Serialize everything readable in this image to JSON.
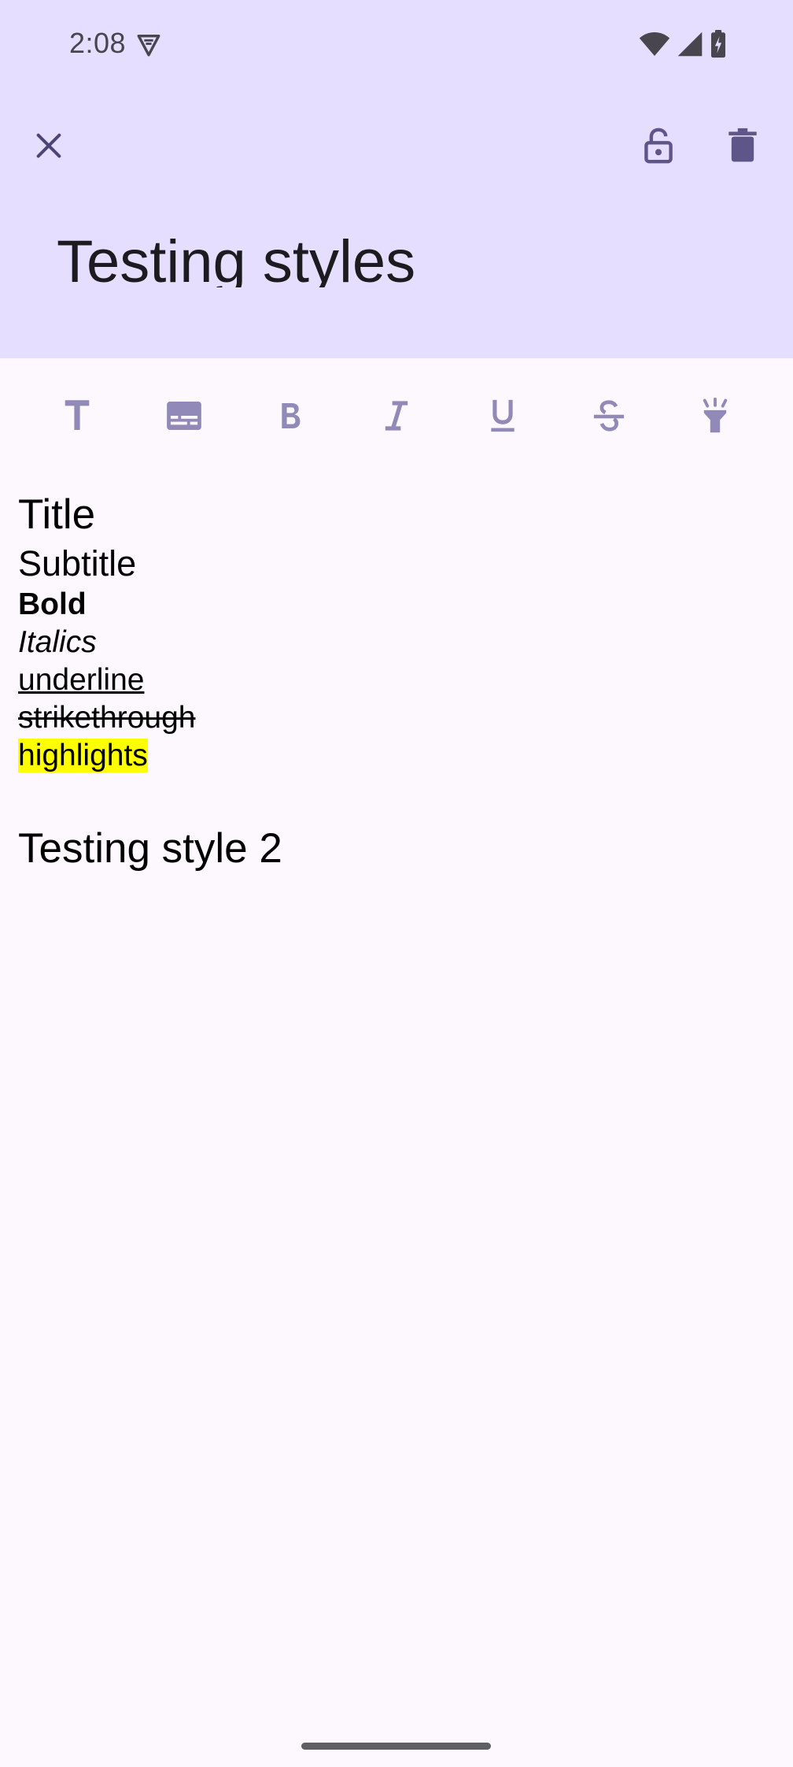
{
  "status_bar": {
    "time": "2:08"
  },
  "header": {
    "title": "Testing styles",
    "background": "#e5defe",
    "icons": {
      "close": "close-icon",
      "lock": "lock-open-icon",
      "delete": "delete-icon"
    }
  },
  "format_toolbar": {
    "buttons": [
      {
        "name": "title-format",
        "glyph": "T"
      },
      {
        "name": "subtitle-format",
        "glyph": "subtitles-icon"
      },
      {
        "name": "bold-format",
        "glyph": "B"
      },
      {
        "name": "italic-format",
        "glyph": "I"
      },
      {
        "name": "underline-format",
        "glyph": "U"
      },
      {
        "name": "strikethrough-format",
        "glyph": "S"
      },
      {
        "name": "highlight-format",
        "glyph": "flashlight-icon"
      }
    ],
    "icon_color": "#9189b8"
  },
  "body": {
    "lines": {
      "title": "Title",
      "subtitle": "Subtitle",
      "bold": "Bold",
      "italics": "Italics",
      "underline": "underline",
      "strikethrough": "strikethrough",
      "highlights": "highlights",
      "second_title": "Testing style 2"
    },
    "highlight_color": "#ffff00"
  }
}
